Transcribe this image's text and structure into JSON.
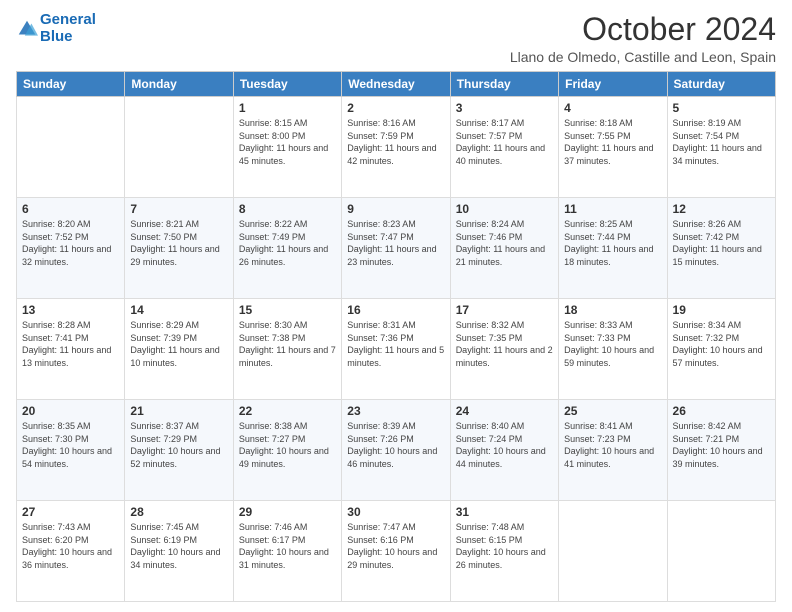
{
  "logo": {
    "line1": "General",
    "line2": "Blue"
  },
  "title": "October 2024",
  "location": "Llano de Olmedo, Castille and Leon, Spain",
  "days_of_week": [
    "Sunday",
    "Monday",
    "Tuesday",
    "Wednesday",
    "Thursday",
    "Friday",
    "Saturday"
  ],
  "weeks": [
    [
      {
        "day": "",
        "info": ""
      },
      {
        "day": "",
        "info": ""
      },
      {
        "day": "1",
        "info": "Sunrise: 8:15 AM\nSunset: 8:00 PM\nDaylight: 11 hours and 45 minutes."
      },
      {
        "day": "2",
        "info": "Sunrise: 8:16 AM\nSunset: 7:59 PM\nDaylight: 11 hours and 42 minutes."
      },
      {
        "day": "3",
        "info": "Sunrise: 8:17 AM\nSunset: 7:57 PM\nDaylight: 11 hours and 40 minutes."
      },
      {
        "day": "4",
        "info": "Sunrise: 8:18 AM\nSunset: 7:55 PM\nDaylight: 11 hours and 37 minutes."
      },
      {
        "day": "5",
        "info": "Sunrise: 8:19 AM\nSunset: 7:54 PM\nDaylight: 11 hours and 34 minutes."
      }
    ],
    [
      {
        "day": "6",
        "info": "Sunrise: 8:20 AM\nSunset: 7:52 PM\nDaylight: 11 hours and 32 minutes."
      },
      {
        "day": "7",
        "info": "Sunrise: 8:21 AM\nSunset: 7:50 PM\nDaylight: 11 hours and 29 minutes."
      },
      {
        "day": "8",
        "info": "Sunrise: 8:22 AM\nSunset: 7:49 PM\nDaylight: 11 hours and 26 minutes."
      },
      {
        "day": "9",
        "info": "Sunrise: 8:23 AM\nSunset: 7:47 PM\nDaylight: 11 hours and 23 minutes."
      },
      {
        "day": "10",
        "info": "Sunrise: 8:24 AM\nSunset: 7:46 PM\nDaylight: 11 hours and 21 minutes."
      },
      {
        "day": "11",
        "info": "Sunrise: 8:25 AM\nSunset: 7:44 PM\nDaylight: 11 hours and 18 minutes."
      },
      {
        "day": "12",
        "info": "Sunrise: 8:26 AM\nSunset: 7:42 PM\nDaylight: 11 hours and 15 minutes."
      }
    ],
    [
      {
        "day": "13",
        "info": "Sunrise: 8:28 AM\nSunset: 7:41 PM\nDaylight: 11 hours and 13 minutes."
      },
      {
        "day": "14",
        "info": "Sunrise: 8:29 AM\nSunset: 7:39 PM\nDaylight: 11 hours and 10 minutes."
      },
      {
        "day": "15",
        "info": "Sunrise: 8:30 AM\nSunset: 7:38 PM\nDaylight: 11 hours and 7 minutes."
      },
      {
        "day": "16",
        "info": "Sunrise: 8:31 AM\nSunset: 7:36 PM\nDaylight: 11 hours and 5 minutes."
      },
      {
        "day": "17",
        "info": "Sunrise: 8:32 AM\nSunset: 7:35 PM\nDaylight: 11 hours and 2 minutes."
      },
      {
        "day": "18",
        "info": "Sunrise: 8:33 AM\nSunset: 7:33 PM\nDaylight: 10 hours and 59 minutes."
      },
      {
        "day": "19",
        "info": "Sunrise: 8:34 AM\nSunset: 7:32 PM\nDaylight: 10 hours and 57 minutes."
      }
    ],
    [
      {
        "day": "20",
        "info": "Sunrise: 8:35 AM\nSunset: 7:30 PM\nDaylight: 10 hours and 54 minutes."
      },
      {
        "day": "21",
        "info": "Sunrise: 8:37 AM\nSunset: 7:29 PM\nDaylight: 10 hours and 52 minutes."
      },
      {
        "day": "22",
        "info": "Sunrise: 8:38 AM\nSunset: 7:27 PM\nDaylight: 10 hours and 49 minutes."
      },
      {
        "day": "23",
        "info": "Sunrise: 8:39 AM\nSunset: 7:26 PM\nDaylight: 10 hours and 46 minutes."
      },
      {
        "day": "24",
        "info": "Sunrise: 8:40 AM\nSunset: 7:24 PM\nDaylight: 10 hours and 44 minutes."
      },
      {
        "day": "25",
        "info": "Sunrise: 8:41 AM\nSunset: 7:23 PM\nDaylight: 10 hours and 41 minutes."
      },
      {
        "day": "26",
        "info": "Sunrise: 8:42 AM\nSunset: 7:21 PM\nDaylight: 10 hours and 39 minutes."
      }
    ],
    [
      {
        "day": "27",
        "info": "Sunrise: 7:43 AM\nSunset: 6:20 PM\nDaylight: 10 hours and 36 minutes."
      },
      {
        "day": "28",
        "info": "Sunrise: 7:45 AM\nSunset: 6:19 PM\nDaylight: 10 hours and 34 minutes."
      },
      {
        "day": "29",
        "info": "Sunrise: 7:46 AM\nSunset: 6:17 PM\nDaylight: 10 hours and 31 minutes."
      },
      {
        "day": "30",
        "info": "Sunrise: 7:47 AM\nSunset: 6:16 PM\nDaylight: 10 hours and 29 minutes."
      },
      {
        "day": "31",
        "info": "Sunrise: 7:48 AM\nSunset: 6:15 PM\nDaylight: 10 hours and 26 minutes."
      },
      {
        "day": "",
        "info": ""
      },
      {
        "day": "",
        "info": ""
      }
    ]
  ]
}
